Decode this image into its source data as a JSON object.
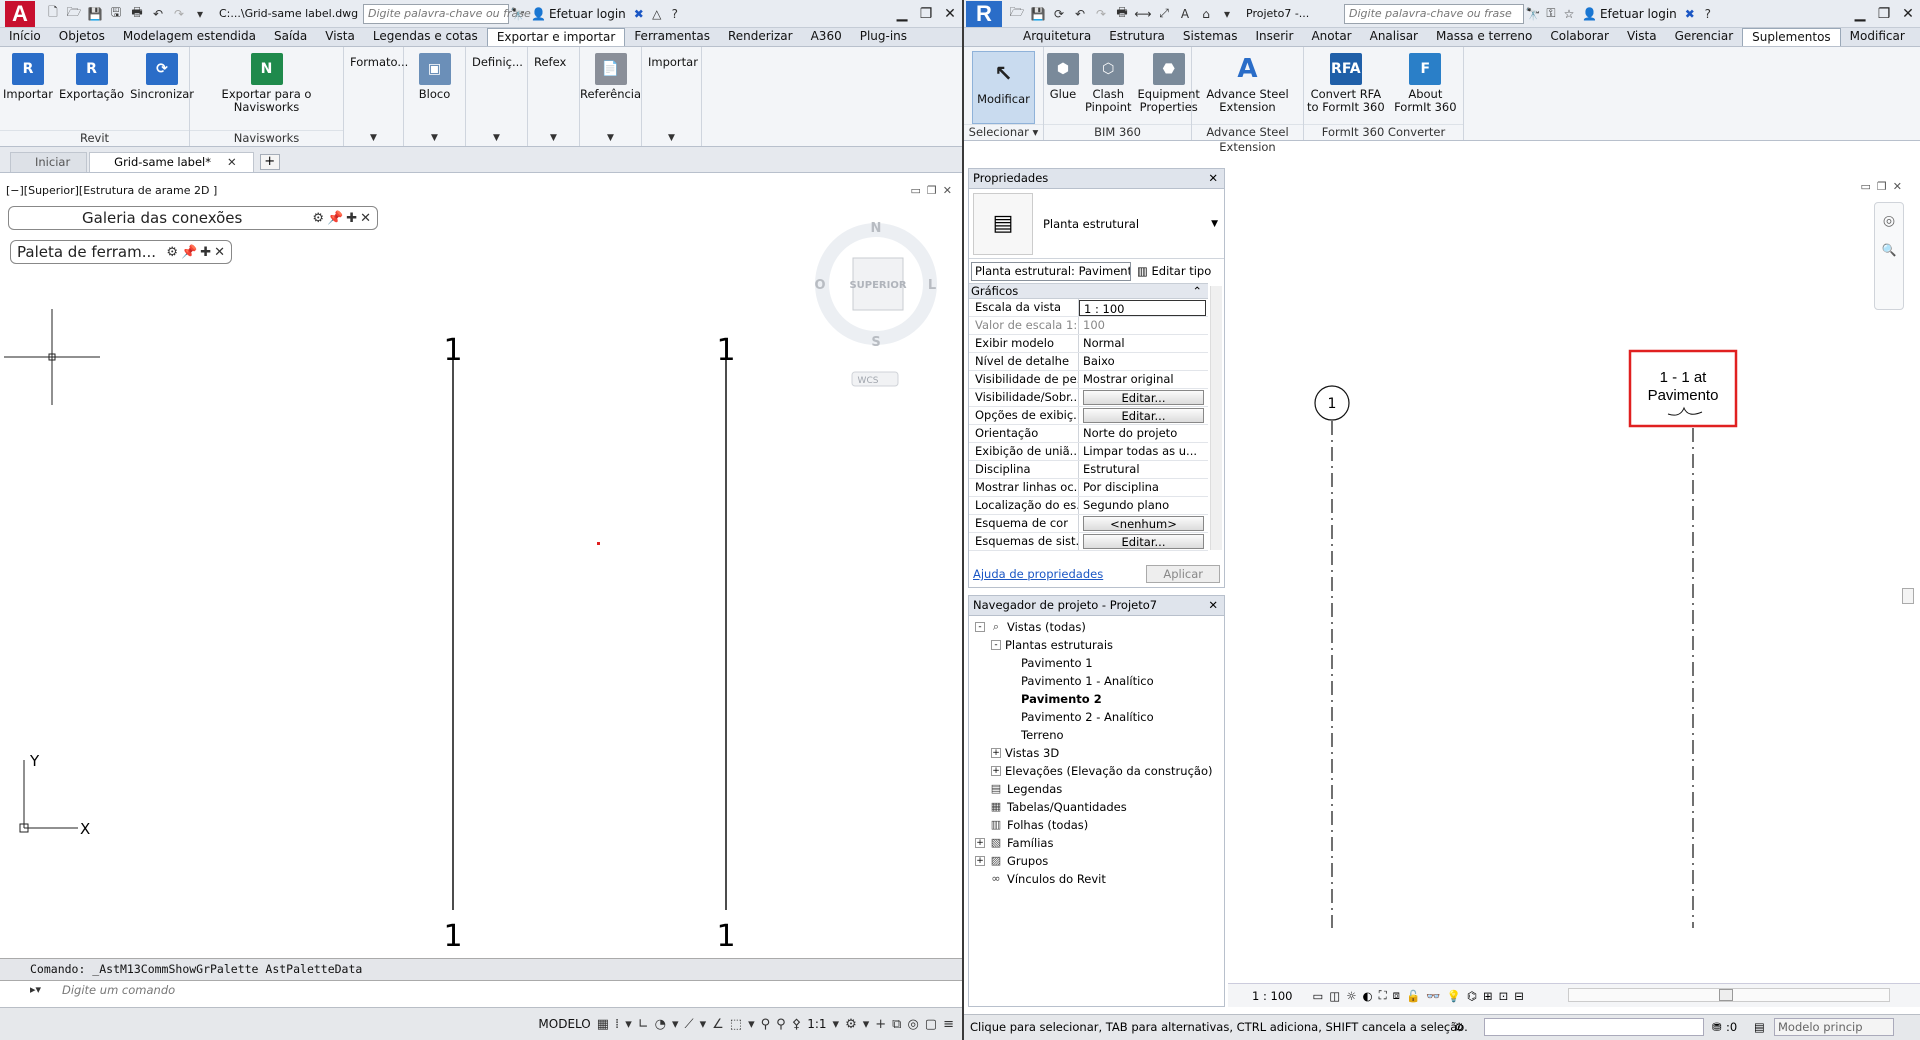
{
  "autocad": {
    "app_logo": "A",
    "title": "C:...\\Grid-same label.dwg",
    "search_placeholder": "Digite palavra-chave ou frase",
    "login": "Efetuar login",
    "tabs": [
      "Início",
      "Objetos",
      "Modelagem estendida",
      "Saída",
      "Vista",
      "Legendas e cotas",
      "Exportar e importar",
      "Ferramentas",
      "Renderizar",
      "A360",
      "Plug-ins"
    ],
    "active_tab": "Exportar e importar",
    "ribbon": {
      "revit_buttons": [
        "Importar",
        "Exportação",
        "Sincronizar"
      ],
      "revit_panel": "Revit",
      "navisworks_button": "Exportar para o Navisworks",
      "navisworks_panel": "Navisworks",
      "formato": "Formato...",
      "bloco": "Bloco",
      "definicoes": "Definiç...",
      "refex": "Refex",
      "referencia": "Referência",
      "importar": "Importar"
    },
    "doc_tabs": [
      "Iniciar",
      "Grid-same label*"
    ],
    "viewport_label": "[−][Superior][Estrutura de arame 2D ]",
    "palette_connections": "Galeria das conexões",
    "palette_tools": "Paleta de ferram...",
    "viewcube": {
      "n": "N",
      "s": "S",
      "o": "O",
      "l": "L",
      "face": "SUPERIOR",
      "wcs": "WCS"
    },
    "grid_labels": {
      "a_top": "1",
      "a_bottom": "1",
      "b_top": "1",
      "b_bottom": "1"
    },
    "ucs": {
      "x": "X",
      "y": "Y"
    },
    "command_history": "Comando: _AstM13CommShowGrPalette AstPaletteData",
    "command_placeholder": "Digite um comando",
    "status": {
      "model": "MODELO",
      "scale": "1:1"
    }
  },
  "revit": {
    "app_logo": "R",
    "title": "Projeto7 -...",
    "search_placeholder": "Digite palavra-chave ou frase",
    "login": "Efetuar login",
    "tabs": [
      "Arquitetura",
      "Estrutura",
      "Sistemas",
      "Inserir",
      "Anotar",
      "Analisar",
      "Massa e terreno",
      "Colaborar",
      "Vista",
      "Gerenciar",
      "Suplementos",
      "Modificar"
    ],
    "active_tab": "Suplementos",
    "ribbon": {
      "modificar": "Modificar",
      "selecionar": "Selecionar",
      "glue": "Glue",
      "clash": "Clash\nPinpoint",
      "equipment": "Equipment\nProperties",
      "bim360": "BIM 360",
      "advance_btn": "Advance Steel\nExtension",
      "advance_panel": "Advance Steel Extension",
      "convert": "Convert RFA\nto FormIt 360",
      "about": "About FormIt 360",
      "formit_panel": "FormIt 360 Converter"
    },
    "properties": {
      "title": "Propriedades",
      "type_name": "Planta estrutural",
      "selector": "Planta estrutural: Paviment",
      "edit_type": "Editar tipo",
      "group": "Gráficos",
      "rows": [
        {
          "k": "Escala da vista",
          "v": "1 : 100"
        },
        {
          "k": "Valor de escala    1:",
          "v": "100"
        },
        {
          "k": "Exibir modelo",
          "v": "Normal"
        },
        {
          "k": "Nível de detalhe",
          "v": "Baixo"
        },
        {
          "k": "Visibilidade de pe...",
          "v": "Mostrar original"
        },
        {
          "k": "Visibilidade/Sobr...",
          "v": "Editar..."
        },
        {
          "k": "Opções de exibiç...",
          "v": "Editar..."
        },
        {
          "k": "Orientação",
          "v": "Norte do projeto"
        },
        {
          "k": "Exibição de uniã...",
          "v": "Limpar todas as u..."
        },
        {
          "k": "Disciplina",
          "v": "Estrutural"
        },
        {
          "k": "Mostrar linhas oc...",
          "v": "Por disciplina"
        },
        {
          "k": "Localização do es...",
          "v": "Segundo plano"
        },
        {
          "k": "Esquema de cor",
          "v": "<nenhum>"
        },
        {
          "k": "Esquemas de sist...",
          "v": "Editar..."
        }
      ],
      "help": "Ajuda de propriedades",
      "apply": "Aplicar"
    },
    "browser": {
      "title": "Navegador de projeto - Projeto7",
      "items": [
        "Vistas (todas)",
        "Plantas estruturais",
        "Pavimento 1",
        "Pavimento 1 - Analítico",
        "Pavimento 2",
        "Pavimento 2 - Analítico",
        "Terreno",
        "Vistas 3D",
        "Elevações (Elevação da construção)",
        "Legendas",
        "Tabelas/Quantidades",
        "Folhas (todas)",
        "Famílias",
        "Grupos",
        "Vínculos do Revit"
      ]
    },
    "canvas": {
      "bubble": "1",
      "tag_line1": "1 - 1 at",
      "tag_line2": "Pavimento",
      "highlight_color": "#e02020"
    },
    "view_scale": "1 : 100",
    "status": "Clique para selecionar, TAB para alternativas, CTRL adiciona, SHIFT cancela a seleção.",
    "status_zero": ":0",
    "model_box": "Modelo princip"
  }
}
